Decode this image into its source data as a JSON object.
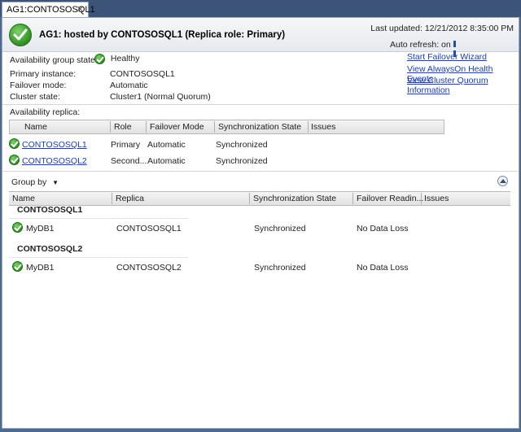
{
  "tab": {
    "title": "AG1:CONTOSOSQL1",
    "close": "✕"
  },
  "header": {
    "title": "AG1: hosted by CONTOSOSQL1 (Replica role: Primary)",
    "last_updated": "Last updated: 12/21/2012 8:35:00 PM",
    "auto_refresh": "Auto refresh: on"
  },
  "summary": {
    "state_label": "Availability group state:",
    "state_value": "Healthy",
    "primary_label": "Primary instance:",
    "primary_value": "CONTOSOSQL1",
    "failover_label": "Failover mode:",
    "failover_value": "Automatic",
    "cluster_label": "Cluster state:",
    "cluster_value": "Cluster1 (Normal Quorum)"
  },
  "links": {
    "failover_wizard": "Start Failover Wizard",
    "health_events": "View AlwaysOn Health Events",
    "quorum_info": "View Cluster Quorum Information"
  },
  "replicas": {
    "label": "Availability replica:",
    "columns": [
      "Name",
      "Role",
      "Failover Mode",
      "Synchronization State",
      "Issues"
    ],
    "rows": [
      {
        "name": "CONTOSOSQL1",
        "role": "Primary",
        "failover": "Automatic",
        "sync": "Synchronized",
        "issues": ""
      },
      {
        "name": "CONTOSOSQL2",
        "role": "Second...",
        "failover": "Automatic",
        "sync": "Synchronized",
        "issues": ""
      }
    ]
  },
  "databases": {
    "group_by": "Group by",
    "columns": [
      "Name",
      "Replica",
      "Synchronization State",
      "Failover Readin...",
      "Issues"
    ],
    "groups": [
      {
        "label": "CONTOSOSQL1",
        "rows": [
          {
            "name": "MyDB1",
            "replica": "CONTOSOSQL1",
            "sync": "Synchronized",
            "failover": "No Data Loss"
          }
        ]
      },
      {
        "label": "CONTOSOSQL2",
        "rows": [
          {
            "name": "MyDB1",
            "replica": "CONTOSOSQL2",
            "sync": "Synchronized",
            "failover": "No Data Loss"
          }
        ]
      }
    ]
  }
}
